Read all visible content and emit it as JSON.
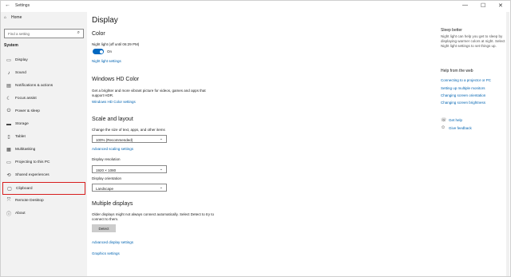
{
  "window": {
    "title": "Settings",
    "back_icon": "←",
    "min_icon": "—",
    "max_icon": "☐",
    "close_icon": "✕"
  },
  "sidebar": {
    "home_icon": "⌂",
    "home_label": "Home",
    "search_placeholder": "Find a setting",
    "search_icon": "⌕",
    "section_title": "System",
    "items": [
      {
        "label": "Display",
        "icon": "▭"
      },
      {
        "label": "Sound",
        "icon": "♪"
      },
      {
        "label": "Notifications & actions",
        "icon": "▤"
      },
      {
        "label": "Focus assist",
        "icon": "☾"
      },
      {
        "label": "Power & sleep",
        "icon": "⏻"
      },
      {
        "label": "Storage",
        "icon": "▬"
      },
      {
        "label": "Tablet",
        "icon": "▯"
      },
      {
        "label": "Multitasking",
        "icon": "▦"
      },
      {
        "label": "Projecting to this PC",
        "icon": "▭"
      },
      {
        "label": "Shared experiences",
        "icon": "⟲"
      },
      {
        "label": "Clipboard",
        "icon": "▢"
      },
      {
        "label": "Remote Desktop",
        "icon": "⤧"
      },
      {
        "label": "About",
        "icon": "ⓘ"
      }
    ],
    "selected_index": 10
  },
  "main": {
    "title": "Display",
    "color": {
      "heading": "Color",
      "night_light_label": "Night light (off until 06:29 PM)",
      "toggle_state": "On",
      "night_light_link": "Night light settings"
    },
    "hdr": {
      "heading": "Windows HD Color",
      "description": "Get a brighter and more vibrant picture for videos, games and apps that support HDR.",
      "link": "Windows HD Color settings"
    },
    "scale": {
      "heading": "Scale and layout",
      "size_label": "Change the size of text, apps, and other items",
      "size_value": "100% (Recommended)",
      "advanced_link": "Advanced scaling settings",
      "resolution_label": "Display resolution",
      "resolution_value": "1920 × 1080",
      "orientation_label": "Display orientation",
      "orientation_value": "Landscape",
      "chevron": "⌄"
    },
    "multi": {
      "heading": "Multiple displays",
      "description": "Older displays might not always connect automatically. Select Detect to try to connect to them.",
      "detect_button": "Detect",
      "advanced_link": "Advanced display settings",
      "graphics_link": "Graphics settings"
    }
  },
  "right": {
    "sleep_heading": "Sleep better",
    "sleep_text": "Night light can help you get to sleep by displaying warmer colors at night. Select Night light settings to set things up.",
    "help_heading": "Help from the web",
    "help_links": [
      "Connecting to a projector or PC",
      "Setting up multiple monitors",
      "Changing screen orientation",
      "Changing screen brightness"
    ],
    "get_help": "Get help",
    "get_help_icon": "☏",
    "feedback": "Give feedback",
    "feedback_icon": "☺"
  },
  "colors": {
    "accent": "#0067c0",
    "link": "#0063b1",
    "highlight": "#d71e1e",
    "sidebar_bg": "#f2f2f2"
  }
}
